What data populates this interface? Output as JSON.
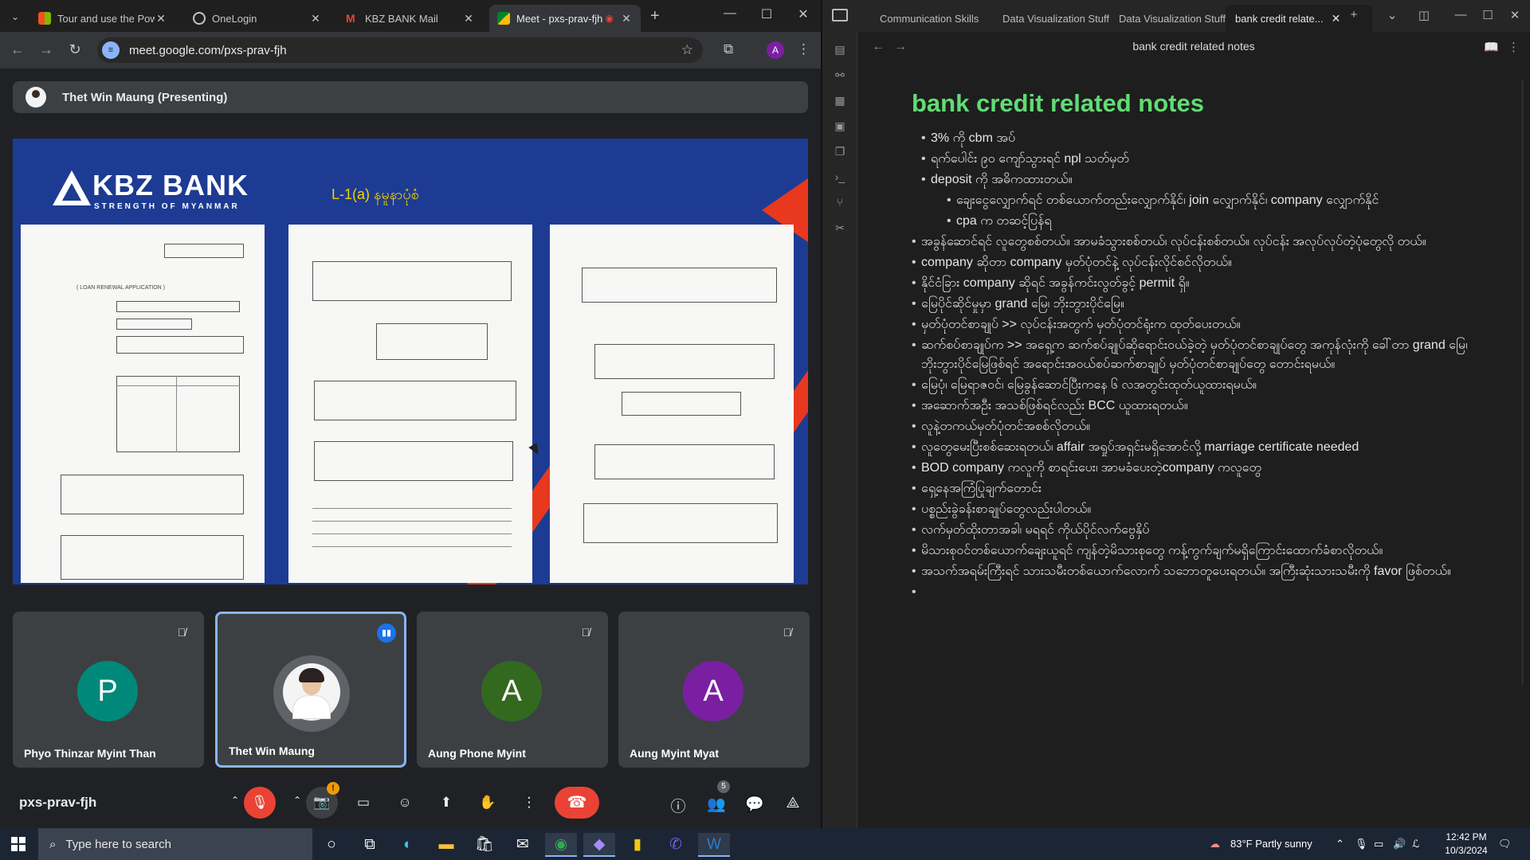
{
  "browser": {
    "tabs": [
      {
        "title": "Tour and use the Power",
        "active": false
      },
      {
        "title": "OneLogin",
        "active": false
      },
      {
        "title": "KBZ BANK Mail",
        "active": false
      },
      {
        "title": "Meet - pxs-prav-fjh",
        "active": true
      }
    ],
    "url": "meet.google.com/pxs-prav-fjh",
    "profile_initial": "A"
  },
  "meet": {
    "presenting_label": "Thet Win Maung (Presenting)",
    "meeting_code": "pxs-prav-fjh",
    "participants_count": "5",
    "participants": [
      {
        "name": "Phyo Thinzar Myint Than",
        "initial": "P",
        "color": "#00897b",
        "muted": true
      },
      {
        "name": "Thet Win Maung",
        "initial": "",
        "color": "#5f6368",
        "muted": false,
        "speaking": true
      },
      {
        "name": "Aung Phone Myint",
        "initial": "A",
        "color": "#33691e",
        "muted": true
      },
      {
        "name": "Aung Myint Myat",
        "initial": "A",
        "color": "#7b1fa2",
        "muted": true
      }
    ]
  },
  "slide": {
    "logo_text": "KBZ BANK",
    "logo_subtitle": "STRENGTH OF MYANMAR",
    "form_title": "L-1(a) နမူနာပုံစံ",
    "page1_title": "( LOAN RENEWAL APPLICATION )"
  },
  "notes": {
    "tabs": [
      "Communication Skills",
      "Data Visualization Stuff",
      "Data Visualization Stuff",
      "bank credit relate..."
    ],
    "header_title": "bank credit related notes",
    "heading": "bank credit related notes",
    "items": [
      {
        "level": 1,
        "text": "3% ကို cbm အပ်"
      },
      {
        "level": 1,
        "text": "ရက်ပေါင်း ၉၀ ကျော်သွားရင် npl သတ်မှတ်"
      },
      {
        "level": 1,
        "text": "deposit ကို အဓိကထားတယ်။"
      },
      {
        "level": 2,
        "text": "ချေးငွေလျှောက်ရင် တစ်ယောက်တည်းလျှောက်နိုင်၊ join လျှောက်နိုင်၊ company လျှောက်နိုင်"
      },
      {
        "level": 2,
        "text": "cpa က တဆင့်ပြန်ရ"
      },
      {
        "level": 0,
        "text": "အခွန်ဆောင်ရင် လူတွေစစ်တယ်။ အာမခံသွားစစ်တယ်၊ လုပ်ငန်းစစ်တယ်။ လုပ်ငန်း အလုပ်လုပ်တဲ့ပုံတွေလို တယ်။"
      },
      {
        "level": 0,
        "text": "company ဆိုတာ company မှတ်ပုံတင်နဲ့ လုပ်ငန်းလိုင်စင်လိုတယ်။"
      },
      {
        "level": 0,
        "text": "နိုင်ငံခြား company ဆိုရင် အခွန်ကင်းလွတ်ခွင့် permit ရှိ။"
      },
      {
        "level": 0,
        "text": "မြေပိုင်ဆိုင်မှုမှာ grand မြေ၊ ဘိုးဘွားပိုင်မြေ။"
      },
      {
        "level": 0,
        "text": "မှတ်ပုံတင်စာချုပ် >> လုပ်ငန်းအတွက် မှတ်ပုံတင်ရုံးက ထုတ်ပေးတယ်။"
      },
      {
        "level": 0,
        "text": "ဆက်စပ်စာချုပ်က >> အရှေ့က ဆက်စပ်ချုပ်ဆိုရောင်းဝယ်ခဲ့တဲ့ မှတ်ပုံတင်စာချုပ်တွေ အကုန်လုံးကို ခေါ်တာ grand မြေ၊ ဘိုးဘွားပိုင်မြေဖြစ်ရင် အရောင်းအဝယ်စပ်ဆက်စာချုပ် မှတ်ပုံတင်စာချုပ်တွေ တောင်းရမယ်။"
      },
      {
        "level": 0,
        "text": "မြေပုံ၊ မြေရာဇဝင်၊ မြေခွန်ဆောင်ပြီးကနေ ၆ လအတွင်းထုတ်ယူထားရမယ်။"
      },
      {
        "level": 0,
        "text": "အဆောက်အဦး အသစ်ဖြစ်ရင်လည်း BCC ယူထားရတယ်။"
      },
      {
        "level": 0,
        "text": "လူနဲ့တကယ်မှတ်ပုံတင်အစစ်လိုတယ်။"
      },
      {
        "level": 0,
        "text": "လူတွေမေးပြီးစစ်ဆေးရတယ်၊ affair အရှုပ်အရှင်းမရှိအောင်လို့ marriage certificate needed"
      },
      {
        "level": 0,
        "text": "BOD company ကလူကို စာရင်းပေး၊ အာမခံပေးတဲ့company ကလူတွေ"
      },
      {
        "level": 0,
        "text": "ရှေ့နေအကြံပြုချက်တောင်း"
      },
      {
        "level": 0,
        "text": "ပစ္စည်းခွဲခန်းစာချုပ်တွေလည်းပါတယ်။"
      },
      {
        "level": 0,
        "text": "လက်မှတ်ထိုးတာအခါ၊ မရရင် ကိုယ်ပိုင်လက်ဗွေနှိပ်"
      },
      {
        "level": 0,
        "text": "မိသားစုဝင်တစ်ယောက်ချေးယူရင် ကျန်တဲ့မိသားစုတွေ ကန့်ကွက်ချက်မရှိကြောင်းထောက်ခံစာလိုတယ်။"
      },
      {
        "level": 0,
        "text": "အသက်အရမ်းကြီးရင် သားသမီးတစ်ယောက်လောက် သဘောတူပေးရတယ်။ အကြီးဆုံးသားသမီးကို favor ဖြစ်တယ်။"
      },
      {
        "level": 0,
        "text": ""
      }
    ]
  },
  "taskbar": {
    "search_placeholder": "Type here to search",
    "weather": "83°F  Partly sunny",
    "time": "12:42 PM",
    "date": "10/3/2024"
  }
}
